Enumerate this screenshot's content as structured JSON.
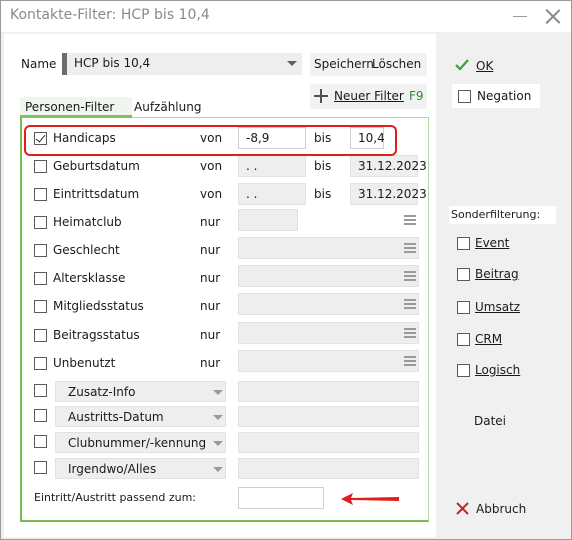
{
  "window": {
    "title": "Kontakte-Filter: HCP bis 10,4"
  },
  "header": {
    "name_label": "Name",
    "name_value": "HCP bis 10,4",
    "save_label": "Speichern",
    "delete_label": "Löschen",
    "new_filter_label": "Neuer Filter",
    "new_filter_shortcut": "F9"
  },
  "tabs": [
    {
      "label": "Personen-Filter",
      "active": true
    },
    {
      "label": "Aufzählung",
      "active": false
    }
  ],
  "rows": [
    {
      "label": "Handicaps",
      "checked": true,
      "op": "von",
      "from": "-8,9",
      "op2": "bis",
      "to": "10,4"
    },
    {
      "label": "Geburtsdatum",
      "checked": false,
      "op": "von",
      "from": " . .",
      "op2": "bis",
      "to": "31.12.2023"
    },
    {
      "label": "Eintrittsdatum",
      "checked": false,
      "op": "von",
      "from": " . .",
      "op2": "bis",
      "to": "31.12.2023"
    },
    {
      "label": "Heimatclub",
      "checked": false,
      "op": "nur"
    },
    {
      "label": "Geschlecht",
      "checked": false,
      "op": "nur"
    },
    {
      "label": "Altersklasse",
      "checked": false,
      "op": "nur"
    },
    {
      "label": "Mitgliedsstatus",
      "checked": false,
      "op": "nur"
    },
    {
      "label": "Beitragsstatus",
      "checked": false,
      "op": "nur"
    },
    {
      "label": "Unbenutzt",
      "checked": false,
      "op": "nur"
    }
  ],
  "dropdown_rows": [
    {
      "label": "Zusatz-Info"
    },
    {
      "label": "Austritts-Datum"
    },
    {
      "label": "Clubnummer/-kennung"
    },
    {
      "label": "Irgendwo/Alles"
    }
  ],
  "footer": {
    "match_label": "Eintritt/Austritt passend zum:"
  },
  "side": {
    "ok_label": "OK",
    "negation_label": "Negation",
    "special_label": "Sonderfilterung:",
    "options": [
      "Event",
      "Beitrag",
      "Umsatz",
      "CRM",
      "Logisch"
    ],
    "file_label": "Datei",
    "cancel_label": "Abbruch"
  },
  "colors": {
    "accent_green": "#7aba55",
    "highlight_red": "#e01e1e",
    "ok_check": "#3aa03a",
    "cancel_x": "#d02020"
  }
}
